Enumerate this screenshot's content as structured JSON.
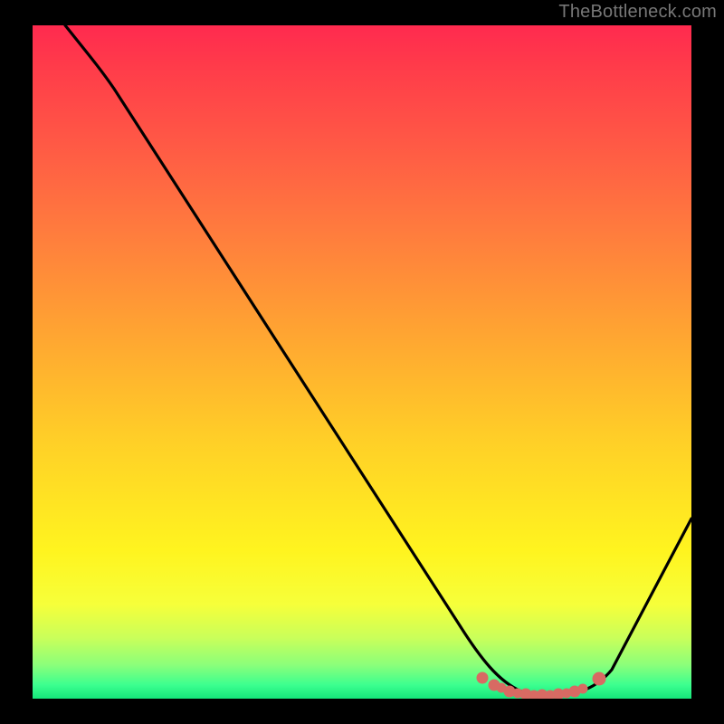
{
  "watermark": "TheBottleneck.com",
  "chart_data": {
    "type": "line",
    "title": "",
    "xlabel": "",
    "ylabel": "",
    "xlim": [
      0,
      100
    ],
    "ylim": [
      0,
      100
    ],
    "grid": false,
    "series": [
      {
        "name": "bottleneck-curve",
        "color": "#000000",
        "x": [
          5,
          10,
          20,
          30,
          40,
          50,
          60,
          66,
          70,
          74,
          78,
          82,
          86,
          92,
          100
        ],
        "y": [
          100,
          94,
          80,
          66,
          52,
          38,
          24,
          14,
          7,
          2,
          0,
          0,
          2,
          10,
          27
        ]
      }
    ],
    "marker_region": {
      "color": "#d86a63",
      "x_start": 68,
      "x_end": 85,
      "description": "optimal region dots along valley bottom"
    },
    "background_gradient": {
      "top": "#ff2a4f",
      "mid": "#ffd027",
      "bottom": "#15e57a"
    }
  }
}
